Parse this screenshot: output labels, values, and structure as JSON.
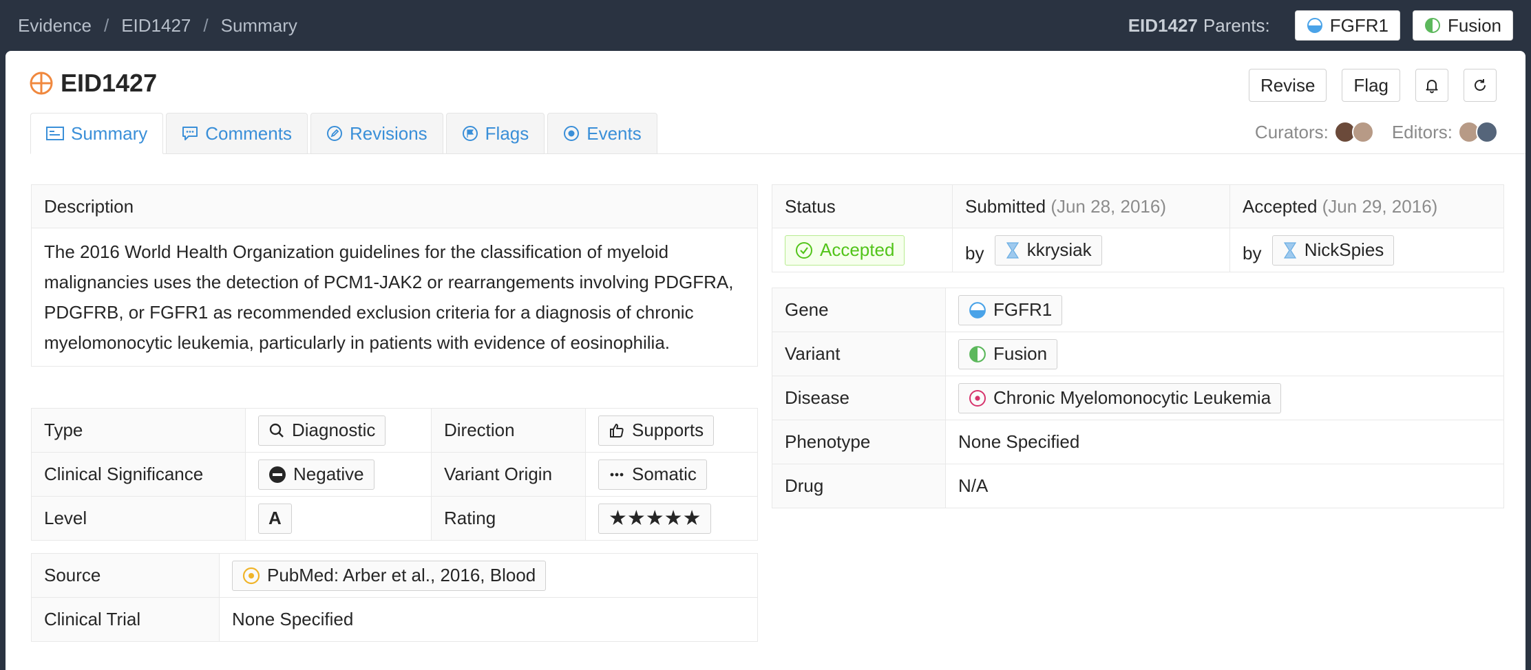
{
  "breadcrumb": [
    "Evidence",
    "EID1427",
    "Summary"
  ],
  "parents": {
    "eid": "EID1427",
    "label": "Parents:",
    "items": [
      {
        "label": "FGFR1",
        "icon": "gene-icon"
      },
      {
        "label": "Fusion",
        "icon": "variant-icon"
      }
    ]
  },
  "header": {
    "title": "EID1427",
    "icon": "evidence-icon",
    "actions": {
      "revise": "Revise",
      "flag": "Flag"
    }
  },
  "tabs": [
    {
      "label": "Summary",
      "icon": "summary-icon",
      "active": true
    },
    {
      "label": "Comments",
      "icon": "comments-icon"
    },
    {
      "label": "Revisions",
      "icon": "revisions-icon"
    },
    {
      "label": "Flags",
      "icon": "flags-icon"
    },
    {
      "label": "Events",
      "icon": "events-icon"
    }
  ],
  "team": {
    "curators_label": "Curators:",
    "editors_label": "Editors:"
  },
  "description": {
    "header": "Description",
    "text": "The 2016 World Health Organization guidelines for the classification of myeloid malignancies uses the detection of PCM1-JAK2 or rearrangements involving PDGFRA, PDGFRB, or FGFR1 as recommended exclusion criteria for a diagnosis of chronic myelomonocytic leukemia, particularly in patients with evidence of eosinophilia."
  },
  "attributes": {
    "type_label": "Type",
    "type_value": "Diagnostic",
    "direction_label": "Direction",
    "direction_value": "Supports",
    "clinsig_label": "Clinical Significance",
    "clinsig_value": "Negative",
    "origin_label": "Variant Origin",
    "origin_value": "Somatic",
    "level_label": "Level",
    "level_value": "A",
    "rating_label": "Rating",
    "rating_value": 5,
    "rating_stars": "★★★★★"
  },
  "source": {
    "source_label": "Source",
    "source_value": "PubMed: Arber et al., 2016, Blood",
    "trial_label": "Clinical Trial",
    "trial_value": "None Specified"
  },
  "status": {
    "status_label": "Status",
    "status_value": "Accepted",
    "submitted_label": "Submitted",
    "submitted_date": "(Jun 28, 2016)",
    "submitted_by_prefix": "by",
    "submitted_by": "kkrysiak",
    "accepted_label": "Accepted",
    "accepted_date": "(Jun 29, 2016)",
    "accepted_by_prefix": "by",
    "accepted_by": "NickSpies"
  },
  "entities": {
    "gene_label": "Gene",
    "gene_value": "FGFR1",
    "variant_label": "Variant",
    "variant_value": "Fusion",
    "disease_label": "Disease",
    "disease_value": "Chronic Myelomonocytic Leukemia",
    "phenotype_label": "Phenotype",
    "phenotype_value": "None Specified",
    "drug_label": "Drug",
    "drug_value": "N/A"
  },
  "colors": {
    "topbar": "#2a3341",
    "accent": "#3a8fd8",
    "accepted": "#52c41a",
    "evidence": "#f0883e"
  }
}
